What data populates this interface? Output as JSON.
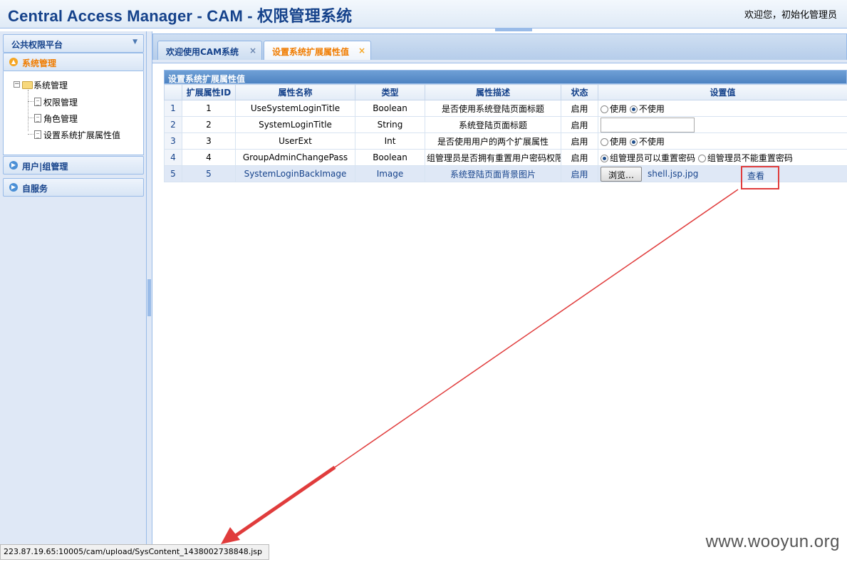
{
  "header": {
    "title": "Central Access Manager - CAM - 权限管理系统",
    "welcome": "欢迎您，初始化管理员"
  },
  "sidebar": {
    "platform": "公共权限平台",
    "sections": [
      {
        "label": "系统管理"
      },
      {
        "label": "用户|组管理"
      },
      {
        "label": "自服务"
      }
    ],
    "tree": {
      "root": "系统管理",
      "children": [
        "权限管理",
        "角色管理",
        "设置系统扩展属性值"
      ]
    }
  },
  "tabs": [
    {
      "label": "欢迎使用CAM系统",
      "close": "×"
    },
    {
      "label": "设置系统扩展属性值",
      "close": "×"
    }
  ],
  "grid": {
    "title": "设置系统扩展属性值",
    "columns": [
      "",
      "扩展属性ID",
      "属性名称",
      "类型",
      "属性描述",
      "状态",
      "设置值"
    ],
    "rows": [
      {
        "num": "1",
        "id": "1",
        "name": "UseSystemLoginTitle",
        "type": "Boolean",
        "desc": "是否使用系统登陆页面标题",
        "status": "启用",
        "opt_a": "使用",
        "opt_b": "不使用"
      },
      {
        "num": "2",
        "id": "2",
        "name": "SystemLoginTitle",
        "type": "String",
        "desc": "系统登陆页面标题",
        "status": "启用"
      },
      {
        "num": "3",
        "id": "3",
        "name": "UserExt",
        "type": "Int",
        "desc": "是否使用用户的两个扩展属性",
        "status": "启用",
        "opt_a": "使用",
        "opt_b": "不使用"
      },
      {
        "num": "4",
        "id": "4",
        "name": "GroupAdminChangePass",
        "type": "Boolean",
        "desc": "组管理员是否拥有重置用户密码权限",
        "status": "启用",
        "opt_a": "组管理员可以重置密码",
        "opt_b": "组管理员不能重置密码"
      },
      {
        "num": "5",
        "id": "5",
        "name": "SystemLoginBackImage",
        "type": "Image",
        "desc": "系统登陆页面背景图片",
        "status": "启用",
        "browse": "浏览…",
        "file": "shell.jsp.jpg",
        "view": "查看"
      }
    ]
  },
  "status_bar": "223.87.19.65:10005/cam/upload/SysContent_1438002738848.jsp",
  "watermark": "www.wooyun.org",
  "colors": {
    "accent": "#15428b",
    "active_tab": "#f07c00",
    "annotation": "#e03c3c"
  }
}
